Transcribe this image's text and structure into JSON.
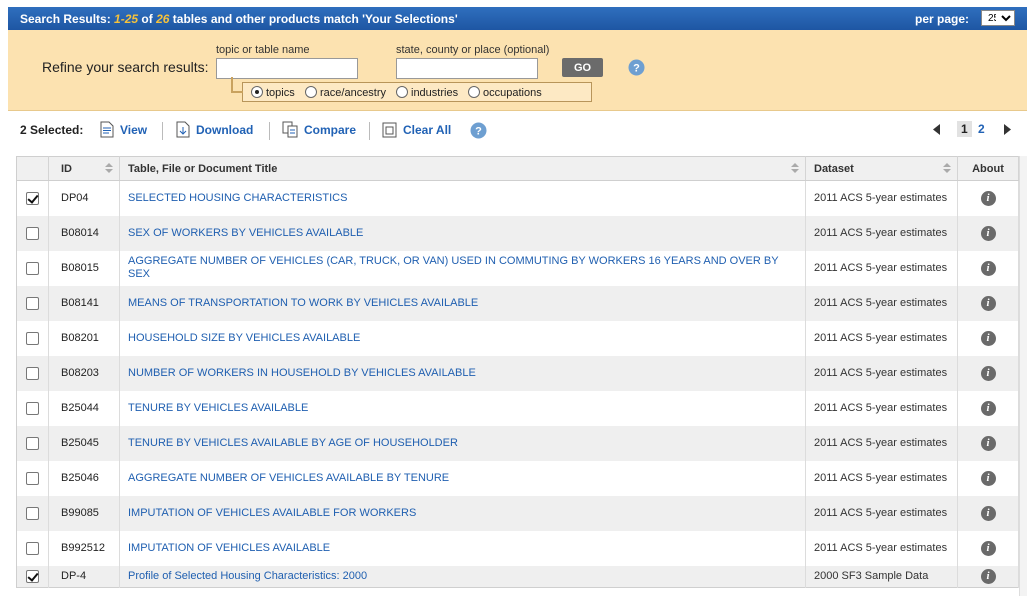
{
  "header": {
    "prefix": "Search Results:",
    "range": "1-25",
    "of": "of",
    "total": "26",
    "suffix": "tables and other products match 'Your Selections'",
    "per_page_label": "per page:",
    "per_page_value": "25"
  },
  "refine": {
    "label": "Refine your search results:",
    "topic_caption": "topic or table name",
    "place_caption": "state, county or place (optional)",
    "topic_value": "",
    "place_value": "",
    "go_label": "GO",
    "options": [
      {
        "label": "topics",
        "selected": true
      },
      {
        "label": "race/ancestry",
        "selected": false
      },
      {
        "label": "industries",
        "selected": false
      },
      {
        "label": "occupations",
        "selected": false
      }
    ]
  },
  "toolbar": {
    "selected_label": "2 Selected:",
    "view": "View",
    "download": "Download",
    "compare": "Compare",
    "clear_all": "Clear All"
  },
  "pager": {
    "current": "1",
    "next": "2"
  },
  "table": {
    "headers": {
      "id": "ID",
      "title": "Table, File or Document Title",
      "dataset": "Dataset",
      "about": "About"
    },
    "rows": [
      {
        "checked": true,
        "id": "DP04",
        "title": "SELECTED HOUSING CHARACTERISTICS",
        "dataset": "2011 ACS 5-year estimates"
      },
      {
        "checked": false,
        "id": "B08014",
        "title": "SEX OF WORKERS BY VEHICLES AVAILABLE",
        "dataset": "2011 ACS 5-year estimates"
      },
      {
        "checked": false,
        "id": "B08015",
        "title": "AGGREGATE NUMBER OF VEHICLES (CAR, TRUCK, OR VAN) USED IN COMMUTING BY WORKERS 16 YEARS AND OVER BY SEX",
        "dataset": "2011 ACS 5-year estimates"
      },
      {
        "checked": false,
        "id": "B08141",
        "title": "MEANS OF TRANSPORTATION TO WORK BY VEHICLES AVAILABLE",
        "dataset": "2011 ACS 5-year estimates"
      },
      {
        "checked": false,
        "id": "B08201",
        "title": "HOUSEHOLD SIZE BY VEHICLES AVAILABLE",
        "dataset": "2011 ACS 5-year estimates"
      },
      {
        "checked": false,
        "id": "B08203",
        "title": "NUMBER OF WORKERS IN HOUSEHOLD BY VEHICLES AVAILABLE",
        "dataset": "2011 ACS 5-year estimates"
      },
      {
        "checked": false,
        "id": "B25044",
        "title": "TENURE BY VEHICLES AVAILABLE",
        "dataset": "2011 ACS 5-year estimates"
      },
      {
        "checked": false,
        "id": "B25045",
        "title": "TENURE BY VEHICLES AVAILABLE BY AGE OF HOUSEHOLDER",
        "dataset": "2011 ACS 5-year estimates"
      },
      {
        "checked": false,
        "id": "B25046",
        "title": "AGGREGATE NUMBER OF VEHICLES AVAILABLE BY TENURE",
        "dataset": "2011 ACS 5-year estimates"
      },
      {
        "checked": false,
        "id": "B99085",
        "title": "IMPUTATION OF VEHICLES AVAILABLE FOR WORKERS",
        "dataset": "2011 ACS 5-year estimates"
      },
      {
        "checked": false,
        "id": "B992512",
        "title": "IMPUTATION OF VEHICLES AVAILABLE",
        "dataset": "2011 ACS 5-year estimates"
      },
      {
        "checked": true,
        "id": "DP-4",
        "title": "Profile of Selected Housing Characteristics: 2000",
        "dataset": "2000 SF3 Sample Data"
      }
    ]
  },
  "colors": {
    "header_bg": "#1e56a3",
    "accent_number": "#f5c23c",
    "refine_bg": "#fce2b0",
    "link": "#1f5fb0"
  }
}
